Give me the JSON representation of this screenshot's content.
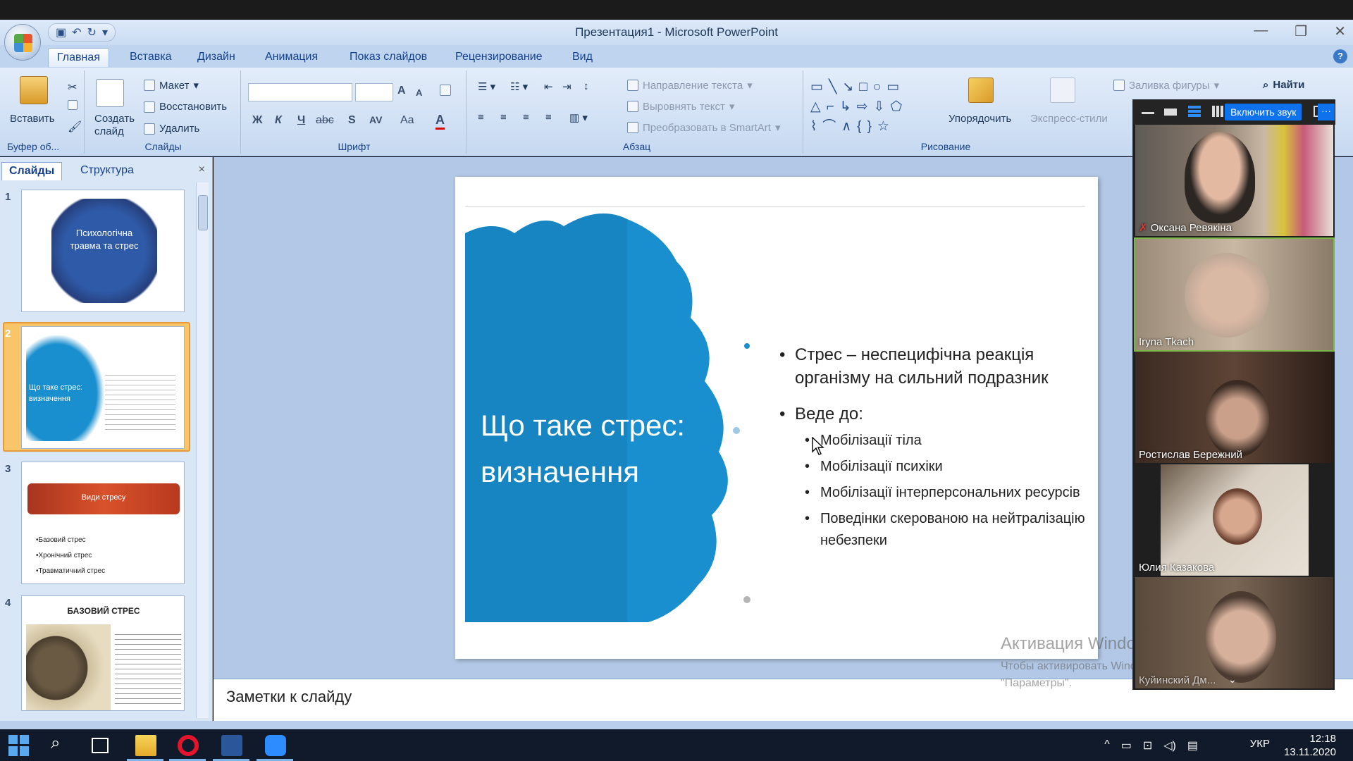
{
  "window": {
    "title": "Презентация1 - Microsoft PowerPoint"
  },
  "ribbon": {
    "tabs": [
      "Главная",
      "Вставка",
      "Дизайн",
      "Анимация",
      "Показ слайдов",
      "Рецензирование",
      "Вид"
    ],
    "active_tab": "Главная",
    "clipboard": {
      "paste_label": "Вставить",
      "group_label": "Буфер об..."
    },
    "slides_group": {
      "new_slide_label": "Создать слайд",
      "layout_label": "Макет",
      "reset_label": "Восстановить",
      "delete_label": "Удалить",
      "group_label": "Слайды"
    },
    "font_group": {
      "group_label": "Шрифт",
      "bold": "Ж",
      "italic": "К",
      "underline": "Ч",
      "strike": "abc",
      "shadow": "S",
      "spacing": "AV",
      "case": "Aa",
      "color": "A",
      "grow": "A",
      "shrink": "A"
    },
    "paragraph_group": {
      "group_label": "Абзац",
      "text_direction": "Направление текста",
      "align_text": "Выровнять текст",
      "smartart": "Преобразовать в SmartArt"
    },
    "drawing_group": {
      "group_label": "Рисование",
      "arrange": "Упорядочить",
      "quick_styles": "Экспресс-стили",
      "shape_fill": "Заливка фигуры"
    },
    "find_label": "Найти"
  },
  "left_panel": {
    "tabs": [
      "Слайды",
      "Структура"
    ],
    "close": "×",
    "thumbnails": [
      {
        "num": "1",
        "text": "Психологічна травма та стрес"
      },
      {
        "num": "2",
        "title": "Що таке стрес: визначення"
      },
      {
        "num": "3",
        "title": "Види стресу",
        "items": [
          "•Базовий стрес",
          "•Хронічний стрес",
          "•Травматичний стрес"
        ]
      },
      {
        "num": "4",
        "title": "БАЗОВИЙ СТРЕС"
      }
    ]
  },
  "slide": {
    "title": "Що таке стрес: визначення",
    "bullet1": "Стрес – неспецифічна реакція організму на сильний подразник",
    "bullet2": "Веде до:",
    "sub_bullets": [
      "Мобілізації тіла",
      "Мобілізації психіки",
      "Мобілізації інтерперсональних ресурсів",
      "Поведінки скерованою на нейтралізацію небезпеки"
    ]
  },
  "notes": {
    "placeholder": "Заметки к слайду"
  },
  "activation": {
    "title": "Активация Windows",
    "line1": "Чтобы активировать Windows, перейдите в раздел",
    "line2": "\"Параметры\"."
  },
  "zoom": {
    "unmute_label": "Включить звук",
    "more_label": "···",
    "participants": [
      "Оксана Ревякіна",
      "Iryna Tkach",
      "Ростислав Бережний",
      "Юлия Казакова",
      "Куйинский Дм..."
    ]
  },
  "taskbar": {
    "lang": "УКР",
    "time": "12:18",
    "date": "13.11.2020"
  },
  "colors": {
    "slide_blue": "#1a8fcf",
    "ribbon_text": "#15428b",
    "zoom_blue": "#0e72ed"
  }
}
